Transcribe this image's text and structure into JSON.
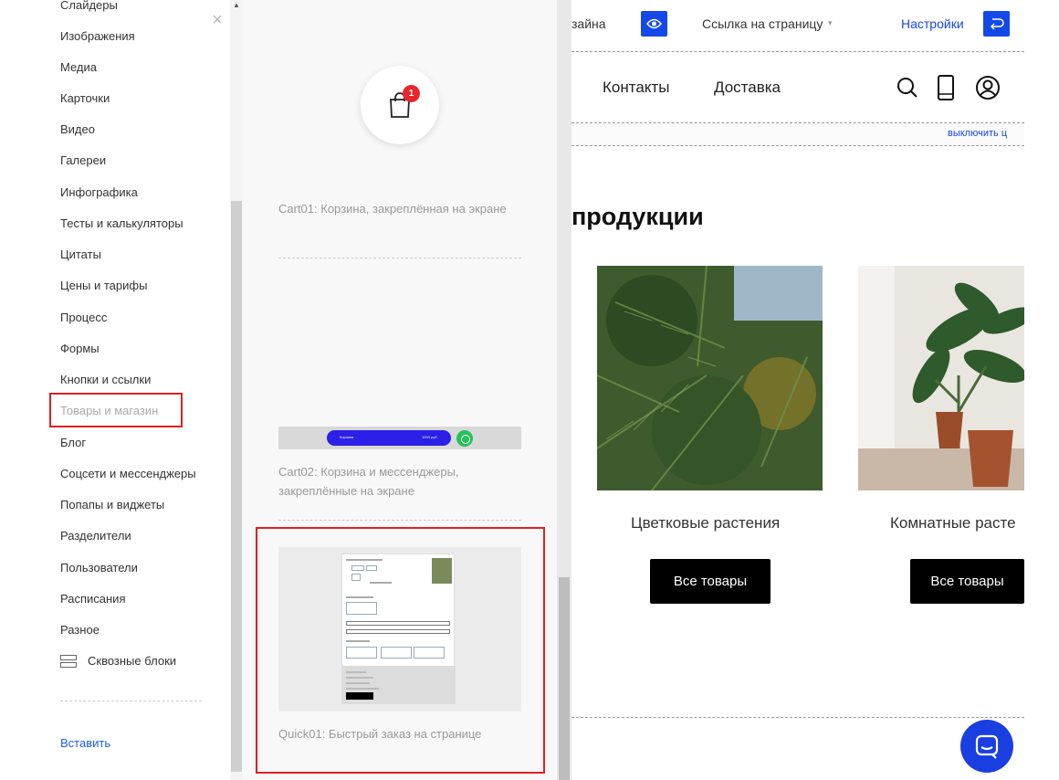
{
  "left_menu": {
    "items": [
      {
        "label": "Слайдеры"
      },
      {
        "label": "Изображения"
      },
      {
        "label": "Медиа"
      },
      {
        "label": "Карточки"
      },
      {
        "label": "Видео"
      },
      {
        "label": "Галереи"
      },
      {
        "label": "Инфографика"
      },
      {
        "label": "Тесты и калькуляторы"
      },
      {
        "label": "Цитаты"
      },
      {
        "label": "Цены и тарифы"
      },
      {
        "label": "Процесс"
      },
      {
        "label": "Формы"
      },
      {
        "label": "Кнопки и ссылки"
      },
      {
        "label": "Товары и магазин",
        "active": true
      },
      {
        "label": "Блог"
      },
      {
        "label": "Соцсети и мессенджеры"
      },
      {
        "label": "Попапы и виджеты"
      },
      {
        "label": "Разделители"
      },
      {
        "label": "Пользователи"
      },
      {
        "label": "Расписания"
      },
      {
        "label": "Разное"
      }
    ],
    "through_blocks_label": "Сквозные блоки",
    "insert_label": "Вставить",
    "close_glyph": "×"
  },
  "blocks": [
    {
      "caption": "Cart01: Корзина, закреплённая на экране",
      "badge": "1"
    },
    {
      "caption": "Cart02: Корзина и мессенджеры, закреплённые на экране",
      "bar_label": "Корзина",
      "bar_price": "1000 руб."
    },
    {
      "caption": "Quick01: Быстрый заказ на странице",
      "selected": true
    }
  ],
  "topbar": {
    "design_text": "зайна",
    "page_link_label": "Ссылка на страницу",
    "page_link_caret": "▾",
    "settings_label": "Настройки"
  },
  "site": {
    "nav": [
      {
        "label": "Контакты"
      },
      {
        "label": "Доставка"
      }
    ],
    "disable_label": "выключить ц",
    "heading": "продукции",
    "products": [
      {
        "title": "Цветковые растения",
        "button": "Все товары"
      },
      {
        "title": "Комнатные расте",
        "button": "Все товары"
      }
    ]
  },
  "colors": {
    "accent_blue": "#1448e8",
    "highlight_red": "#e02020",
    "badge_red": "#e8262b",
    "whatsapp_green": "#25c15b"
  },
  "icons": [
    "close-icon",
    "cart-icon",
    "eye-icon",
    "undo-icon",
    "search-icon",
    "phone-icon",
    "user-icon",
    "chat-icon",
    "layers-icon",
    "whatsapp-icon"
  ]
}
